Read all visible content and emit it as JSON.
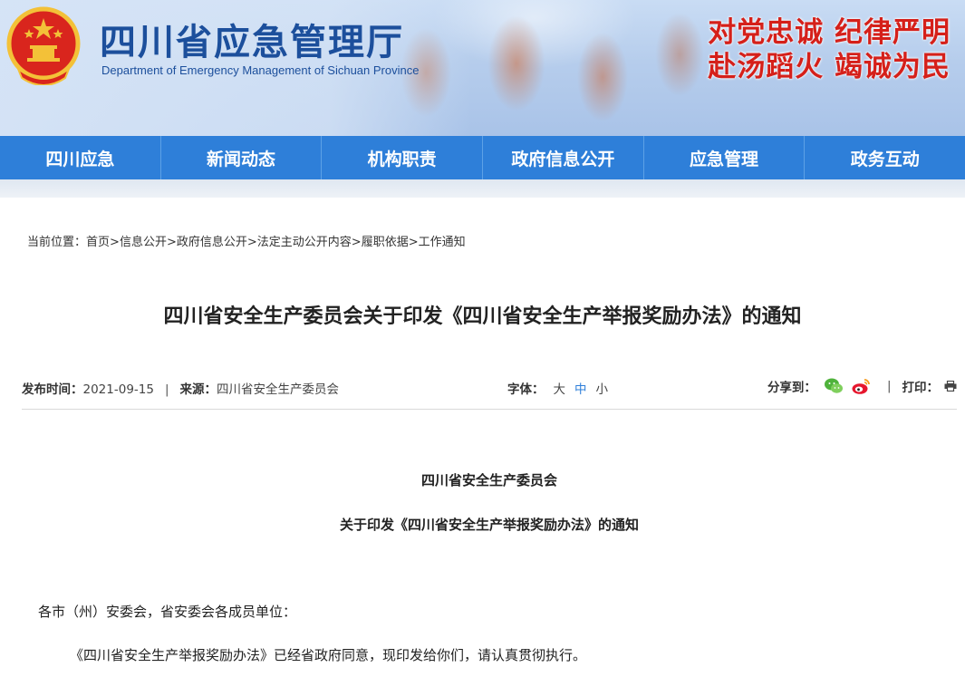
{
  "header": {
    "site_title": "四川省应急管理厅",
    "site_subtitle": "Department of Emergency Management of Sichuan Province",
    "slogan_line1": "对党忠诚  纪律严明",
    "slogan_line2": "赴汤蹈火  竭诚为民",
    "emblem_icon": "national-emblem-icon",
    "colors": {
      "title_blue": "#1c4f9c",
      "slogan_red": "#d5201a",
      "nav_blue": "#2e7fd9"
    }
  },
  "nav": {
    "items": [
      {
        "label": "四川应急"
      },
      {
        "label": "新闻动态"
      },
      {
        "label": "机构职责"
      },
      {
        "label": "政府信息公开"
      },
      {
        "label": "应急管理"
      },
      {
        "label": "政务互动"
      }
    ]
  },
  "breadcrumb": {
    "label": "当前位置：",
    "items": [
      "首页",
      "信息公开",
      "政府信息公开",
      "法定主动公开内容",
      "履职依据",
      "工作通知"
    ],
    "separator": ">"
  },
  "article": {
    "title": "四川省安全生产委员会关于印发《四川省安全生产举报奖励办法》的通知",
    "meta": {
      "date_label": "发布时间：",
      "date": "2021-09-15",
      "divider": "|",
      "source_label": "来源：",
      "source": "四川省安全生产委员会",
      "font_label": "字体：",
      "font_options": [
        "大",
        "中",
        "小"
      ],
      "share_label": "分享到：",
      "share_icons": [
        "wechat-icon",
        "weibo-icon"
      ],
      "print_label": "打印：",
      "print_icon": "printer-icon"
    },
    "body": {
      "issuer": "四川省安全生产委员会",
      "subject": "关于印发《四川省安全生产举报奖励办法》的通知",
      "salutation": "各市（州）安委会，省安委会各成员单位：",
      "paragraph1": "《四川省安全生产举报奖励办法》已经省政府同意，现印发给你们，请认真贯彻执行。"
    }
  }
}
